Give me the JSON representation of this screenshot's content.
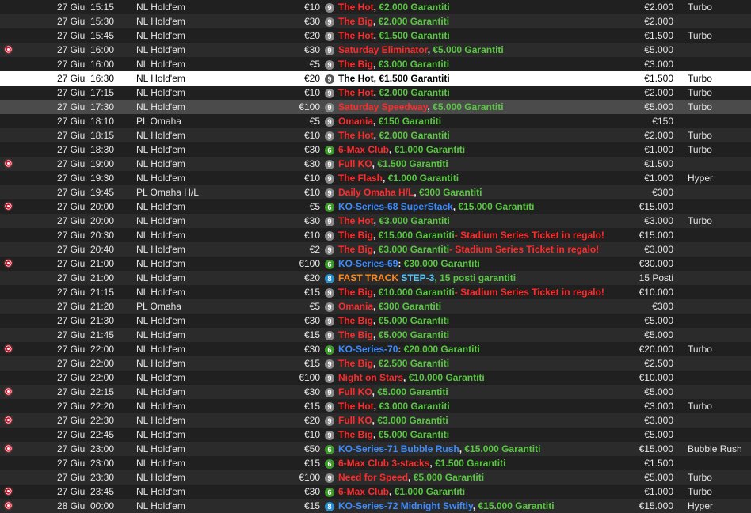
{
  "colors": {
    "red": "#ff2b2b",
    "green": "#58c840",
    "white": "#f2f2f2",
    "blue": "#3b8cff",
    "orange": "#ff8a1e",
    "cyan": "#53c8ff",
    "row_bg": "#202020",
    "row_alt_bg": "#2b2b2b",
    "highlight_bg": "#ffffff",
    "selected_bg": "#4b4b4b"
  },
  "icons": {
    "ko": "knockout-target-icon",
    "badge": "table-size-badge-icon"
  },
  "rows": [
    {
      "ko": false,
      "date": "27 Giu",
      "time": "15:15",
      "game": "NL Hold'em",
      "buyin": "€10",
      "badge": "9",
      "name": [
        {
          "t": "The Hot",
          "c": "red"
        },
        {
          "t": ", ",
          "c": "white"
        },
        {
          "t": "€2.000 Garantiti",
          "c": "green"
        }
      ],
      "prize": "€2.000",
      "speed": "Turbo"
    },
    {
      "ko": false,
      "date": "27 Giu",
      "time": "15:30",
      "game": "NL Hold'em",
      "buyin": "€30",
      "badge": "9",
      "name": [
        {
          "t": "The Big",
          "c": "red"
        },
        {
          "t": ", ",
          "c": "white"
        },
        {
          "t": "€2.000 Garantiti",
          "c": "green"
        }
      ],
      "prize": "€2.000",
      "speed": ""
    },
    {
      "ko": false,
      "date": "27 Giu",
      "time": "15:45",
      "game": "NL Hold'em",
      "buyin": "€20",
      "badge": "9",
      "name": [
        {
          "t": "The Hot",
          "c": "red"
        },
        {
          "t": ", ",
          "c": "white"
        },
        {
          "t": "€1.500 Garantiti",
          "c": "green"
        }
      ],
      "prize": "€1.500",
      "speed": "Turbo"
    },
    {
      "ko": true,
      "date": "27 Giu",
      "time": "16:00",
      "game": "NL Hold'em",
      "buyin": "€30",
      "badge": "9",
      "name": [
        {
          "t": "Saturday Eliminator",
          "c": "red"
        },
        {
          "t": ", ",
          "c": "white"
        },
        {
          "t": "€5.000 Garantiti",
          "c": "green"
        }
      ],
      "prize": "€5.000",
      "speed": ""
    },
    {
      "ko": false,
      "date": "27 Giu",
      "time": "16:00",
      "game": "NL Hold'em",
      "buyin": "€5",
      "badge": "9",
      "name": [
        {
          "t": "The Big",
          "c": "red"
        },
        {
          "t": ", ",
          "c": "white"
        },
        {
          "t": "€3.000 Garantiti",
          "c": "green"
        }
      ],
      "prize": "€3.000",
      "speed": ""
    },
    {
      "ko": false,
      "date": "27 Giu",
      "time": "16:30",
      "game": "NL Hold'em",
      "buyin": "€20",
      "badge": "9",
      "name": [
        {
          "t": "The Hot",
          "c": "red"
        },
        {
          "t": ", ",
          "c": "white"
        },
        {
          "t": "€1.500 Garantiti",
          "c": "green"
        }
      ],
      "prize": "€1.500",
      "speed": "Turbo",
      "state": "hl"
    },
    {
      "ko": false,
      "date": "27 Giu",
      "time": "17:15",
      "game": "NL Hold'em",
      "buyin": "€10",
      "badge": "9",
      "name": [
        {
          "t": "The Hot",
          "c": "red"
        },
        {
          "t": ", ",
          "c": "white"
        },
        {
          "t": "€2.000 Garantiti",
          "c": "green"
        }
      ],
      "prize": "€2.000",
      "speed": "Turbo"
    },
    {
      "ko": false,
      "date": "27 Giu",
      "time": "17:30",
      "game": "NL Hold'em",
      "buyin": "€100",
      "badge": "9",
      "name": [
        {
          "t": "Saturday Speedway",
          "c": "red"
        },
        {
          "t": ", ",
          "c": "white"
        },
        {
          "t": "€5.000 Garantiti",
          "c": "green"
        }
      ],
      "prize": "€5.000",
      "speed": "Turbo",
      "state": "sel"
    },
    {
      "ko": false,
      "date": "27 Giu",
      "time": "18:10",
      "game": "PL Omaha",
      "buyin": "€5",
      "badge": "9",
      "name": [
        {
          "t": "Omania",
          "c": "red"
        },
        {
          "t": ", ",
          "c": "white"
        },
        {
          "t": "€150 Garantiti",
          "c": "green"
        }
      ],
      "prize": "€150",
      "speed": ""
    },
    {
      "ko": false,
      "date": "27 Giu",
      "time": "18:15",
      "game": "NL Hold'em",
      "buyin": "€10",
      "badge": "9",
      "name": [
        {
          "t": "The Hot",
          "c": "red"
        },
        {
          "t": ", ",
          "c": "white"
        },
        {
          "t": "€2.000 Garantiti",
          "c": "green"
        }
      ],
      "prize": "€2.000",
      "speed": "Turbo"
    },
    {
      "ko": false,
      "date": "27 Giu",
      "time": "18:30",
      "game": "NL Hold'em",
      "buyin": "€30",
      "badge": "6",
      "name": [
        {
          "t": "6-Max Club",
          "c": "red"
        },
        {
          "t": ", ",
          "c": "white"
        },
        {
          "t": "€1.000 Garantiti",
          "c": "green"
        }
      ],
      "prize": "€1.000",
      "speed": "Turbo"
    },
    {
      "ko": true,
      "date": "27 Giu",
      "time": "19:00",
      "game": "NL Hold'em",
      "buyin": "€30",
      "badge": "9",
      "name": [
        {
          "t": "Full KO",
          "c": "red"
        },
        {
          "t": ", ",
          "c": "white"
        },
        {
          "t": "€1.500 Garantiti",
          "c": "green"
        }
      ],
      "prize": "€1.500",
      "speed": ""
    },
    {
      "ko": false,
      "date": "27 Giu",
      "time": "19:30",
      "game": "NL Hold'em",
      "buyin": "€10",
      "badge": "9",
      "name": [
        {
          "t": "The Flash",
          "c": "red"
        },
        {
          "t": ", ",
          "c": "white"
        },
        {
          "t": "€1.000 Garantiti",
          "c": "green"
        }
      ],
      "prize": "€1.000",
      "speed": "Hyper"
    },
    {
      "ko": false,
      "date": "27 Giu",
      "time": "19:45",
      "game": "PL Omaha H/L",
      "buyin": "€10",
      "badge": "9",
      "name": [
        {
          "t": "Daily Omaha H/L",
          "c": "red"
        },
        {
          "t": ", ",
          "c": "white"
        },
        {
          "t": "€300 Garantiti",
          "c": "green"
        }
      ],
      "prize": "€300",
      "speed": ""
    },
    {
      "ko": true,
      "date": "27 Giu",
      "time": "20:00",
      "game": "NL Hold'em",
      "buyin": "€5",
      "badge": "6",
      "name": [
        {
          "t": "KO-Series-68 SuperStack",
          "c": "blue"
        },
        {
          "t": ", ",
          "c": "white"
        },
        {
          "t": "€15.000 Garantiti",
          "c": "green"
        }
      ],
      "prize": "€15.000",
      "speed": ""
    },
    {
      "ko": false,
      "date": "27 Giu",
      "time": "20:00",
      "game": "NL Hold'em",
      "buyin": "€30",
      "badge": "9",
      "name": [
        {
          "t": "The Hot",
          "c": "red"
        },
        {
          "t": ", ",
          "c": "white"
        },
        {
          "t": "€3.000 Garantiti",
          "c": "green"
        }
      ],
      "prize": "€3.000",
      "speed": "Turbo"
    },
    {
      "ko": false,
      "date": "27 Giu",
      "time": "20:30",
      "game": "NL Hold'em",
      "buyin": "€10",
      "badge": "9",
      "name": [
        {
          "t": "The Big",
          "c": "red"
        },
        {
          "t": ", ",
          "c": "white"
        },
        {
          "t": "€15.000 Garantiti",
          "c": "green"
        },
        {
          "t": "- Stadium Series Ticket in regalo!",
          "c": "red"
        }
      ],
      "prize": "€15.000",
      "speed": ""
    },
    {
      "ko": false,
      "date": "27 Giu",
      "time": "20:40",
      "game": "NL Hold'em",
      "buyin": "€2",
      "badge": "9",
      "name": [
        {
          "t": "The Big",
          "c": "red"
        },
        {
          "t": ", ",
          "c": "white"
        },
        {
          "t": "€3.000 Garantiti",
          "c": "green"
        },
        {
          "t": "- Stadium Series Ticket in regalo!",
          "c": "red"
        }
      ],
      "prize": "€3.000",
      "speed": ""
    },
    {
      "ko": true,
      "date": "27 Giu",
      "time": "21:00",
      "game": "NL Hold'em",
      "buyin": "€100",
      "badge": "6",
      "name": [
        {
          "t": "KO-Series-69",
          "c": "blue"
        },
        {
          "t": ": ",
          "c": "white"
        },
        {
          "t": "€30.000 Garantiti",
          "c": "green"
        }
      ],
      "prize": "€30.000",
      "speed": ""
    },
    {
      "ko": false,
      "date": "27 Giu",
      "time": "21:00",
      "game": "NL Hold'em",
      "buyin": "€20",
      "badge": "8",
      "name": [
        {
          "t": "FAST TRACK ",
          "c": "orange"
        },
        {
          "t": "STEP-3",
          "c": "cyan"
        },
        {
          "t": ", 15 posti garantiti",
          "c": "green"
        }
      ],
      "prize": "15 Posti",
      "speed": ""
    },
    {
      "ko": false,
      "date": "27 Giu",
      "time": "21:15",
      "game": "NL Hold'em",
      "buyin": "€15",
      "badge": "9",
      "name": [
        {
          "t": "The Big",
          "c": "red"
        },
        {
          "t": ", ",
          "c": "white"
        },
        {
          "t": "€10.000 Garantiti",
          "c": "green"
        },
        {
          "t": "- Stadium Series Ticket in regalo!",
          "c": "red"
        }
      ],
      "prize": "€10.000",
      "speed": ""
    },
    {
      "ko": false,
      "date": "27 Giu",
      "time": "21:20",
      "game": "PL Omaha",
      "buyin": "€5",
      "badge": "9",
      "name": [
        {
          "t": "Omania",
          "c": "red"
        },
        {
          "t": ", ",
          "c": "white"
        },
        {
          "t": "€300 Garantiti",
          "c": "green"
        }
      ],
      "prize": "€300",
      "speed": ""
    },
    {
      "ko": false,
      "date": "27 Giu",
      "time": "21:30",
      "game": "NL Hold'em",
      "buyin": "€30",
      "badge": "9",
      "name": [
        {
          "t": "The Big",
          "c": "red"
        },
        {
          "t": ", ",
          "c": "white"
        },
        {
          "t": "€5.000 Garantiti",
          "c": "green"
        }
      ],
      "prize": "€5.000",
      "speed": ""
    },
    {
      "ko": false,
      "date": "27 Giu",
      "time": "21:45",
      "game": "NL Hold'em",
      "buyin": "€15",
      "badge": "9",
      "name": [
        {
          "t": "The Big",
          "c": "red"
        },
        {
          "t": ", ",
          "c": "white"
        },
        {
          "t": "€5.000 Garantiti",
          "c": "green"
        }
      ],
      "prize": "€5.000",
      "speed": ""
    },
    {
      "ko": true,
      "date": "27 Giu",
      "time": "22:00",
      "game": "NL Hold'em",
      "buyin": "€30",
      "badge": "6",
      "name": [
        {
          "t": "KO-Series-70",
          "c": "blue"
        },
        {
          "t": ": ",
          "c": "white"
        },
        {
          "t": "€20.000 Garantiti",
          "c": "green"
        }
      ],
      "prize": "€20.000",
      "speed": "Turbo"
    },
    {
      "ko": false,
      "date": "27 Giu",
      "time": "22:00",
      "game": "NL Hold'em",
      "buyin": "€15",
      "badge": "9",
      "name": [
        {
          "t": "The Big",
          "c": "red"
        },
        {
          "t": ", ",
          "c": "white"
        },
        {
          "t": "€2.500 Garantiti",
          "c": "green"
        }
      ],
      "prize": "€2.500",
      "speed": ""
    },
    {
      "ko": false,
      "date": "27 Giu",
      "time": "22:00",
      "game": "NL Hold'em",
      "buyin": "€100",
      "badge": "9",
      "name": [
        {
          "t": "Night on Stars",
          "c": "red"
        },
        {
          "t": ", ",
          "c": "white"
        },
        {
          "t": "€10.000 Garantiti",
          "c": "green"
        }
      ],
      "prize": "€10.000",
      "speed": ""
    },
    {
      "ko": true,
      "date": "27 Giu",
      "time": "22:15",
      "game": "NL Hold'em",
      "buyin": "€30",
      "badge": "9",
      "name": [
        {
          "t": "Full KO",
          "c": "red"
        },
        {
          "t": ", ",
          "c": "white"
        },
        {
          "t": "€5.000 Garantiti",
          "c": "green"
        }
      ],
      "prize": "€5.000",
      "speed": ""
    },
    {
      "ko": false,
      "date": "27 Giu",
      "time": "22:20",
      "game": "NL Hold'em",
      "buyin": "€15",
      "badge": "9",
      "name": [
        {
          "t": "The Hot",
          "c": "red"
        },
        {
          "t": ", ",
          "c": "white"
        },
        {
          "t": "€3.000 Garantiti",
          "c": "green"
        }
      ],
      "prize": "€3.000",
      "speed": "Turbo"
    },
    {
      "ko": true,
      "date": "27 Giu",
      "time": "22:30",
      "game": "NL Hold'em",
      "buyin": "€20",
      "badge": "9",
      "name": [
        {
          "t": "Full KO",
          "c": "red"
        },
        {
          "t": ", ",
          "c": "white"
        },
        {
          "t": "€3.000 Garantiti",
          "c": "green"
        }
      ],
      "prize": "€3.000",
      "speed": ""
    },
    {
      "ko": false,
      "date": "27 Giu",
      "time": "22:45",
      "game": "NL Hold'em",
      "buyin": "€10",
      "badge": "9",
      "name": [
        {
          "t": "The Big",
          "c": "red"
        },
        {
          "t": ", ",
          "c": "white"
        },
        {
          "t": "€5.000 Garantiti",
          "c": "green"
        }
      ],
      "prize": "€5.000",
      "speed": ""
    },
    {
      "ko": true,
      "date": "27 Giu",
      "time": "23:00",
      "game": "NL Hold'em",
      "buyin": "€50",
      "badge": "6",
      "name": [
        {
          "t": "KO-Series-71 Bubble Rush",
          "c": "blue"
        },
        {
          "t": ", ",
          "c": "white"
        },
        {
          "t": "€15.000 Garantiti",
          "c": "green"
        }
      ],
      "prize": "€15.000",
      "speed": "Bubble Rush"
    },
    {
      "ko": false,
      "date": "27 Giu",
      "time": "23:00",
      "game": "NL Hold'em",
      "buyin": "€15",
      "badge": "6",
      "name": [
        {
          "t": "6-Max Club 3-stacks",
          "c": "red"
        },
        {
          "t": ", ",
          "c": "white"
        },
        {
          "t": "€1.500 Garantiti",
          "c": "green"
        }
      ],
      "prize": "€1.500",
      "speed": ""
    },
    {
      "ko": false,
      "date": "27 Giu",
      "time": "23:30",
      "game": "NL Hold'em",
      "buyin": "€100",
      "badge": "9",
      "name": [
        {
          "t": "Need for Speed",
          "c": "red"
        },
        {
          "t": ", ",
          "c": "white"
        },
        {
          "t": "€5.000 Garantiti",
          "c": "green"
        }
      ],
      "prize": "€5.000",
      "speed": "Turbo"
    },
    {
      "ko": true,
      "date": "27 Giu",
      "time": "23:45",
      "game": "NL Hold'em",
      "buyin": "€30",
      "badge": "6",
      "name": [
        {
          "t": "6-Max Club",
          "c": "red"
        },
        {
          "t": ", ",
          "c": "white"
        },
        {
          "t": "€1.000 Garantiti",
          "c": "green"
        }
      ],
      "prize": "€1.000",
      "speed": "Turbo"
    },
    {
      "ko": true,
      "date": "28 Giu",
      "time": "00:00",
      "game": "NL Hold'em",
      "buyin": "€15",
      "badge": "8",
      "name": [
        {
          "t": "KO-Series-72 Midnight Swiftly",
          "c": "blue"
        },
        {
          "t": ", ",
          "c": "white"
        },
        {
          "t": "€15.000 Garantiti",
          "c": "green"
        }
      ],
      "prize": "€15.000",
      "speed": "Hyper"
    }
  ]
}
